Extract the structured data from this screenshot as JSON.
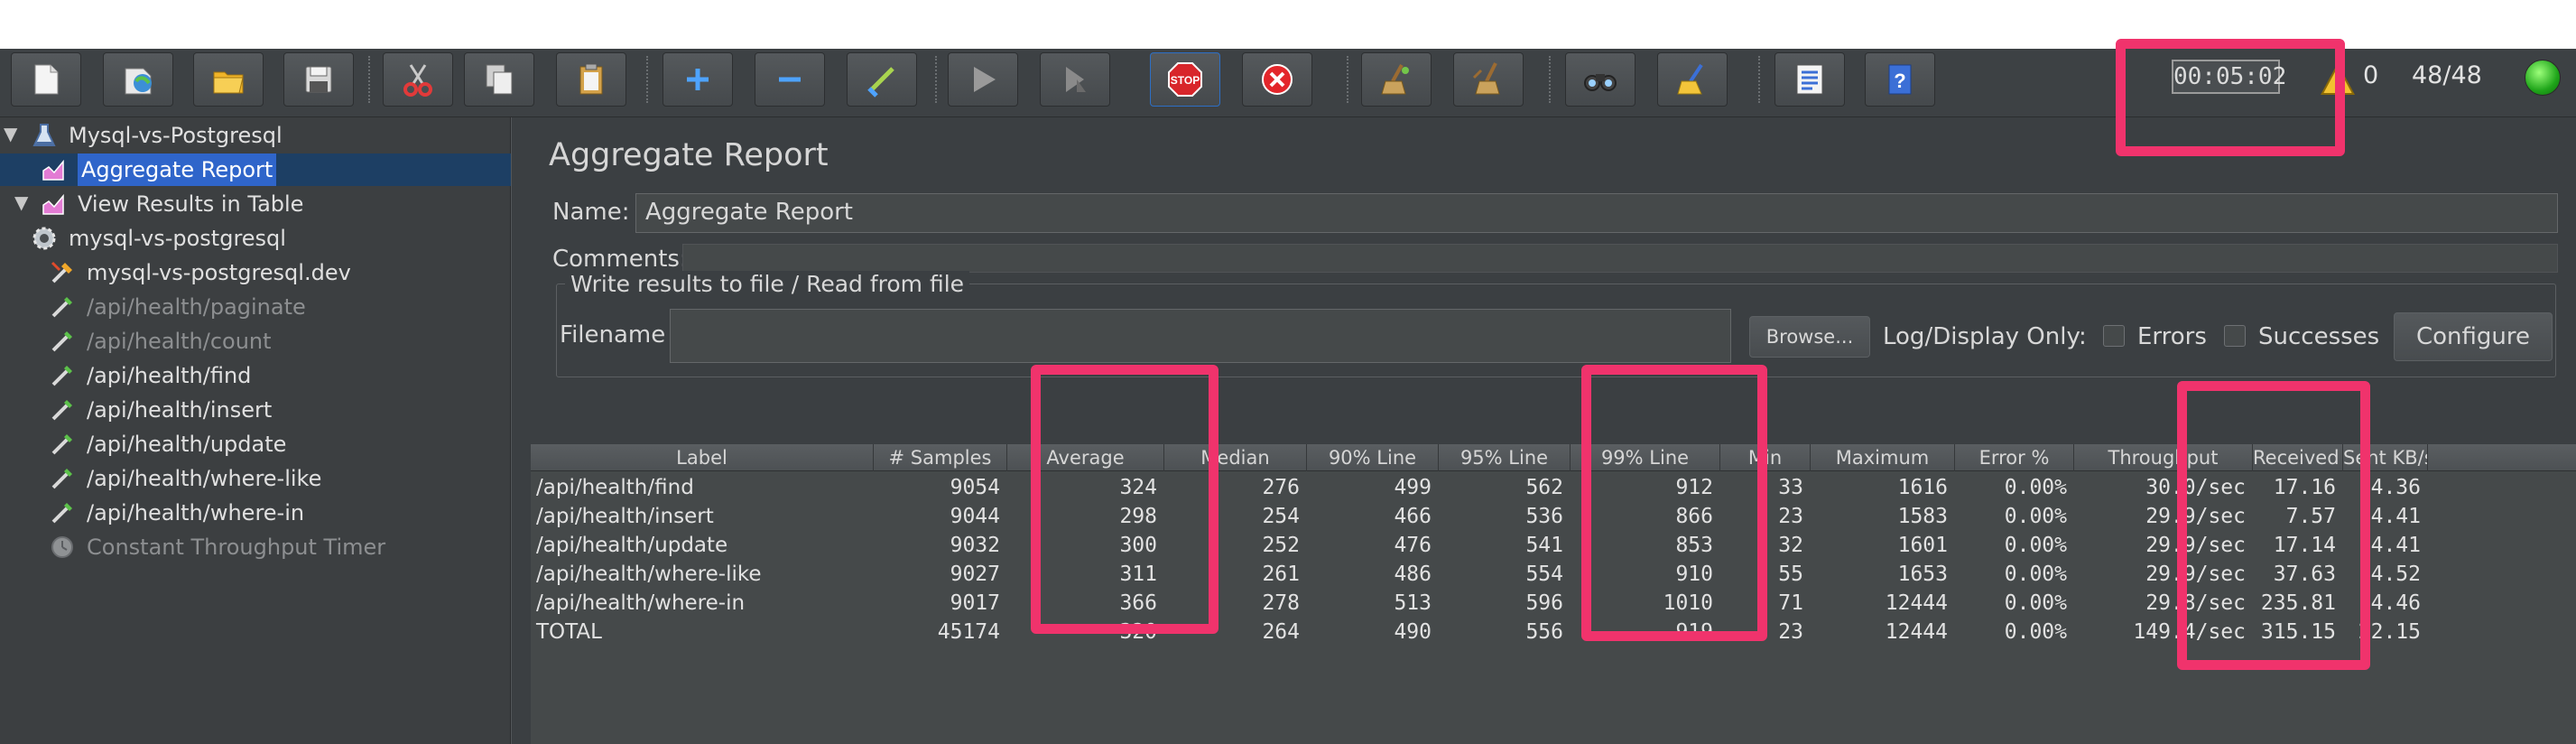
{
  "toolbar": {
    "buttons": [
      {
        "name": "new-icon"
      },
      {
        "name": "templates-icon"
      },
      {
        "name": "open-icon"
      },
      {
        "name": "save-icon"
      },
      {
        "name": "cut-icon"
      },
      {
        "name": "copy-icon"
      },
      {
        "name": "paste-icon"
      },
      {
        "name": "expand-icon"
      },
      {
        "name": "collapse-icon"
      },
      {
        "name": "toggle-icon"
      },
      {
        "name": "start-icon"
      },
      {
        "name": "start-no-pauses-icon"
      },
      {
        "name": "stop-icon"
      },
      {
        "name": "shutdown-icon"
      },
      {
        "name": "clear-icon"
      },
      {
        "name": "clear-all-icon"
      },
      {
        "name": "search-icon"
      },
      {
        "name": "reset-search-icon"
      },
      {
        "name": "function-helper-icon"
      },
      {
        "name": "help-icon"
      }
    ],
    "stop_label": "STOP",
    "timer": "00:05:02",
    "warning_count": "0",
    "threads": "48/48"
  },
  "tree": {
    "items": [
      {
        "label": "Mysql-vs-Postgresql",
        "icon": "test-plan-icon",
        "disabled": false,
        "selected": false
      },
      {
        "label": "Aggregate Report",
        "icon": "chart-icon",
        "disabled": false,
        "selected": true
      },
      {
        "label": "View Results in Table",
        "icon": "chart-icon",
        "disabled": false,
        "selected": false
      },
      {
        "label": "mysql-vs-postgresql",
        "icon": "thread-group-icon",
        "disabled": false,
        "selected": false
      },
      {
        "label": "mysql-vs-postgresql.dev",
        "icon": "http-defaults-icon",
        "disabled": false,
        "selected": false
      },
      {
        "label": "/api/health/paginate",
        "icon": "sampler-icon",
        "disabled": true,
        "selected": false
      },
      {
        "label": "/api/health/count",
        "icon": "sampler-icon",
        "disabled": true,
        "selected": false
      },
      {
        "label": "/api/health/find",
        "icon": "sampler-icon",
        "disabled": false,
        "selected": false
      },
      {
        "label": "/api/health/insert",
        "icon": "sampler-icon",
        "disabled": false,
        "selected": false
      },
      {
        "label": "/api/health/update",
        "icon": "sampler-icon",
        "disabled": false,
        "selected": false
      },
      {
        "label": "/api/health/where-like",
        "icon": "sampler-icon",
        "disabled": false,
        "selected": false
      },
      {
        "label": "/api/health/where-in",
        "icon": "sampler-icon",
        "disabled": false,
        "selected": false
      },
      {
        "label": "Constant Throughput Timer",
        "icon": "timer-icon",
        "disabled": true,
        "selected": false
      }
    ]
  },
  "panel": {
    "title": "Aggregate Report",
    "name_label": "Name:",
    "name_value": "Aggregate Report",
    "comments_label": "Comments:",
    "comments_value": "",
    "group_title": "Write results to file / Read from file",
    "filename_label": "Filename",
    "filename_value": "",
    "browse_label": "Browse...",
    "log_display_label": "Log/Display Only:",
    "errors_label": "Errors",
    "successes_label": "Successes",
    "configure_label": "Configure"
  },
  "table": {
    "columns": [
      "Label",
      "# Samples",
      "Average",
      "Median",
      "90% Line",
      "95% Line",
      "99% Line",
      "Min",
      "Maximum",
      "Error %",
      "Throughput",
      "Received ...",
      "Sent KB/sec"
    ],
    "rows": [
      [
        "/api/health/find",
        "9054",
        "324",
        "276",
        "499",
        "562",
        "912",
        "33",
        "1616",
        "0.00%",
        "30.0/sec",
        "17.16",
        "4.36"
      ],
      [
        "/api/health/insert",
        "9044",
        "298",
        "254",
        "466",
        "536",
        "866",
        "23",
        "1583",
        "0.00%",
        "29.9/sec",
        "7.57",
        "4.41"
      ],
      [
        "/api/health/update",
        "9032",
        "300",
        "252",
        "476",
        "541",
        "853",
        "32",
        "1601",
        "0.00%",
        "29.9/sec",
        "17.14",
        "4.41"
      ],
      [
        "/api/health/where-like",
        "9027",
        "311",
        "261",
        "486",
        "554",
        "910",
        "55",
        "1653",
        "0.00%",
        "29.9/sec",
        "37.63",
        "4.52"
      ],
      [
        "/api/health/where-in",
        "9017",
        "366",
        "278",
        "513",
        "596",
        "1010",
        "71",
        "12444",
        "0.00%",
        "29.8/sec",
        "235.81",
        "4.46"
      ],
      [
        "TOTAL",
        "45174",
        "320",
        "264",
        "490",
        "556",
        "919",
        "23",
        "12444",
        "0.00%",
        "149.4/sec",
        "315.15",
        "22.15"
      ]
    ]
  },
  "highlight_color": "#f0336c"
}
